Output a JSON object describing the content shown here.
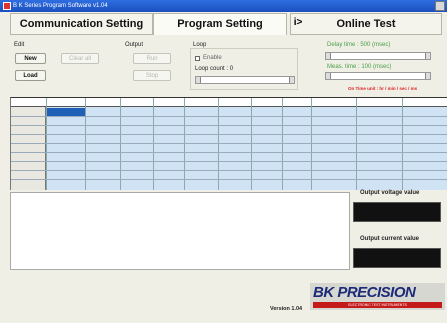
{
  "window": {
    "title": "B K Series Program Software v1.04"
  },
  "tabs": [
    {
      "label": "Communication Setting"
    },
    {
      "label": "Program Setting"
    },
    {
      "label": "Online Test"
    }
  ],
  "tab_arrow": "i>",
  "edit": {
    "label": "Edit",
    "new_label": "New",
    "clear_label": "Clear all",
    "load_label": "Load"
  },
  "output": {
    "label": "Output",
    "run_label": "Run",
    "stop_label": "Stop"
  },
  "loop": {
    "label": "Loop",
    "enable_label": "Enable",
    "count_label": "Loop count : 0"
  },
  "delay_time": {
    "label": "Delay time : 500 (msec)"
  },
  "meas_time": {
    "label": "Meas. time : 100 (msec)"
  },
  "hint": {
    "text": "On Time unit : hr / min / sec / ms"
  },
  "output_voltage": {
    "label": "Output voltage value"
  },
  "output_current": {
    "label": "Output current value"
  },
  "footer": {
    "version": "Version 1.04",
    "brand": "BK PRECISION",
    "tagline": "ELECTRONIC TEST INSTRUMENTS"
  },
  "colors": {
    "accent_green": "#49a046",
    "hint_red": "#d22222",
    "grid_bg": "#cfe3f4",
    "selection": "#1f5fb5",
    "brand_blue": "#1c2a78",
    "brand_red": "#c41a1a"
  },
  "icons": {
    "window_icon": "app-icon",
    "close": "close-icon"
  }
}
